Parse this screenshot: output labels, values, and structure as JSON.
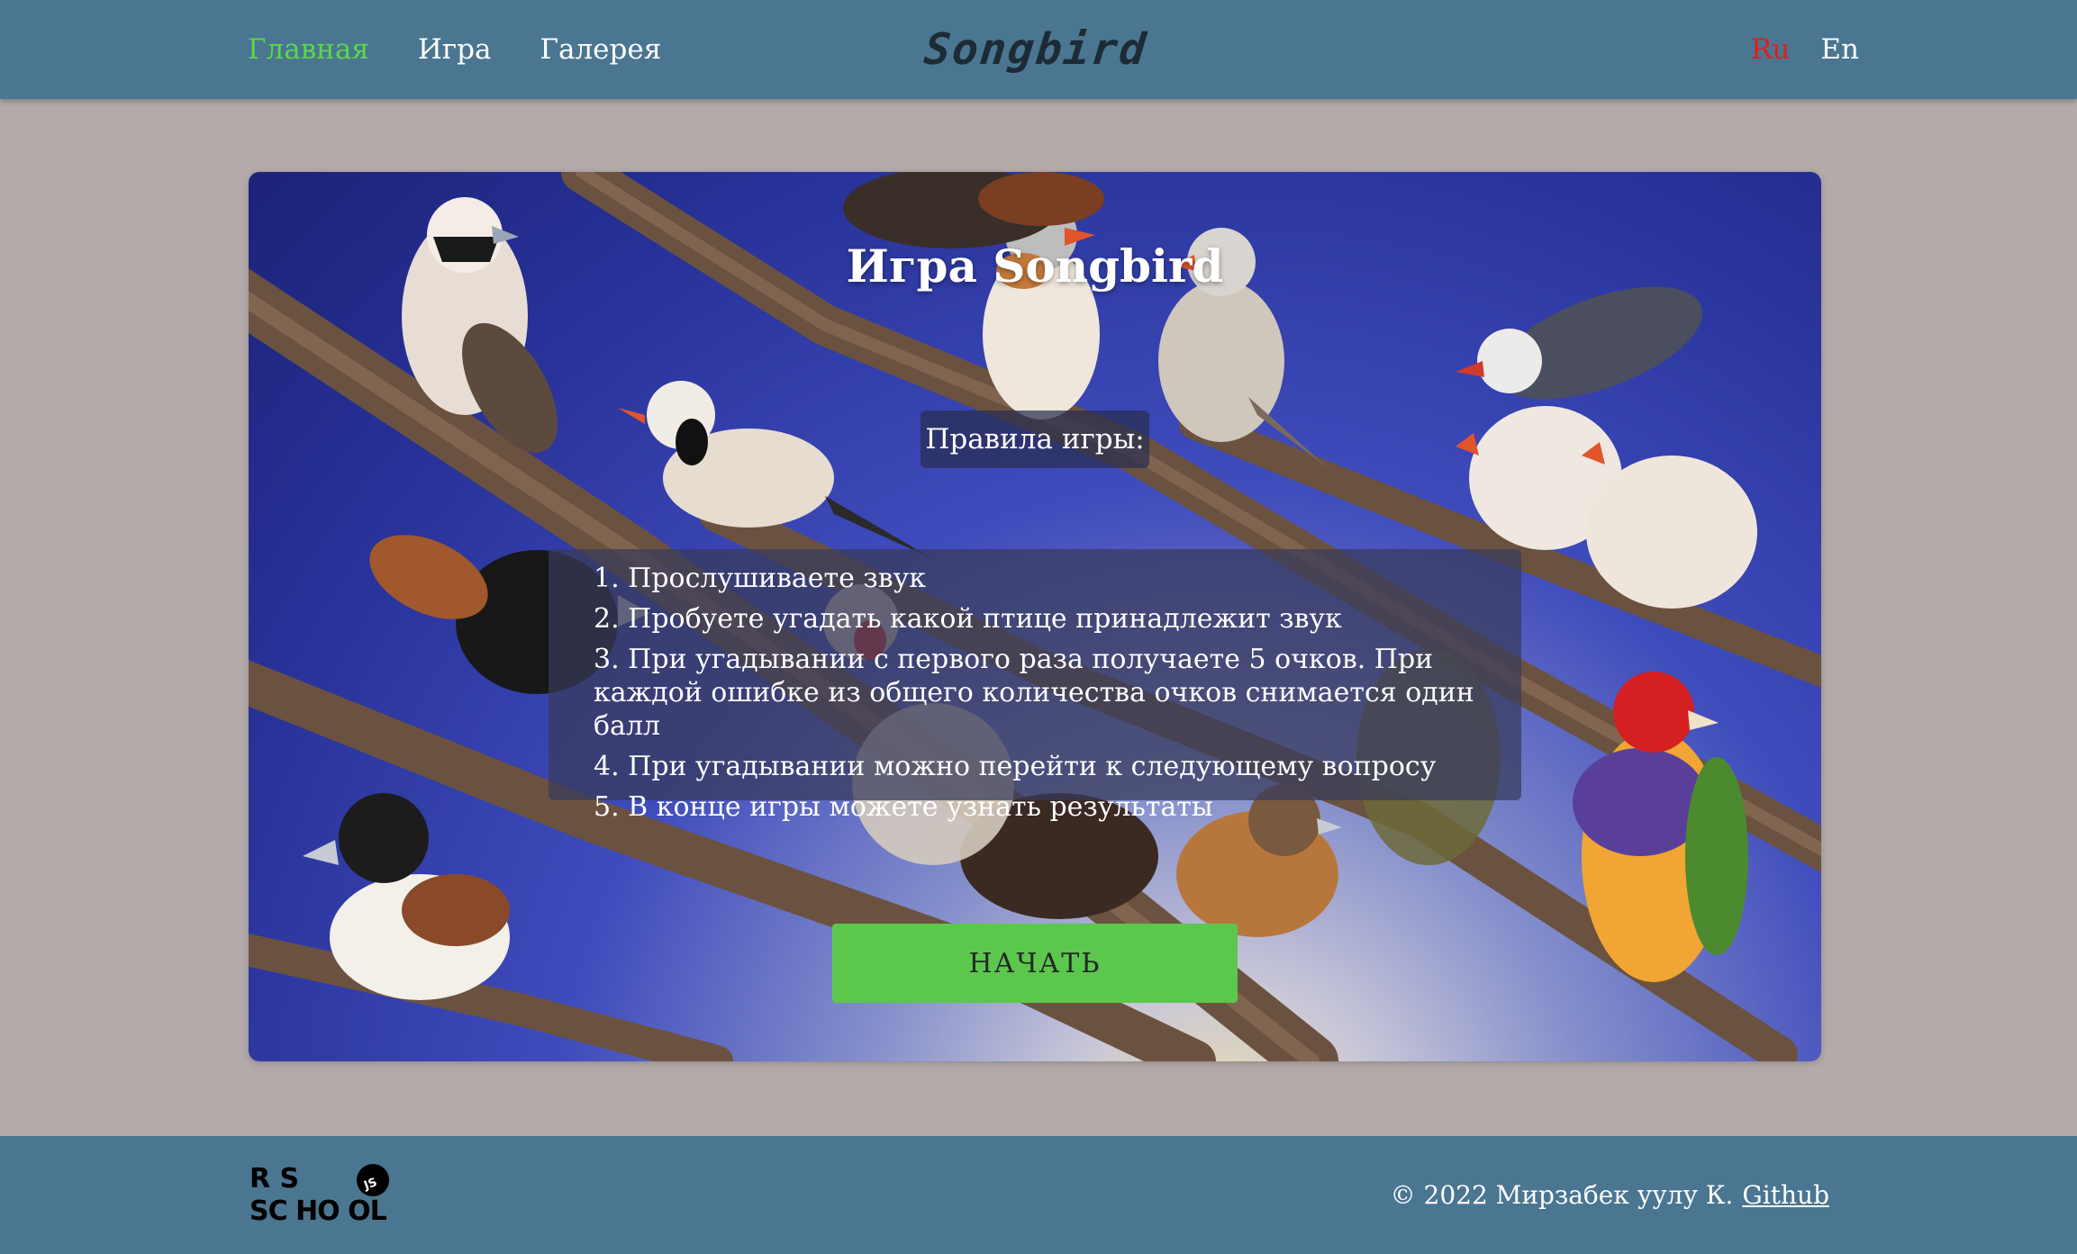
{
  "header": {
    "nav": [
      "Главная",
      "Игра",
      "Галерея"
    ],
    "logo": "Songbird",
    "languages": [
      "Ru",
      "En"
    ]
  },
  "main": {
    "title": "Игра Songbird",
    "rules_heading": "Правила игры:",
    "rules": [
      "1. Прослушиваете звук",
      "2. Пробуете угадать какой птице принадлежит звук",
      "3. При угадывании с первого раза получаете 5 очков. При каждой ошибке из общего количества очков снимается один балл",
      "4. При угадывании можно перейти к следующему вопросу",
      "5. В конце игры можете узнать результаты"
    ],
    "start_button": "НАЧАТЬ"
  },
  "footer": {
    "logo_lines": [
      "R  S",
      "SC HO OL"
    ],
    "logo_badge": "JS",
    "copyright": "© 2022 Мирзабек уулу К.",
    "github_link": "Github"
  },
  "colors": {
    "header_bg": "#4a7691",
    "page_bg": "#b4aaaa",
    "active_nav": "#5cd64a",
    "active_lang": "#e01e1e",
    "button_bg": "#5cc74d"
  }
}
